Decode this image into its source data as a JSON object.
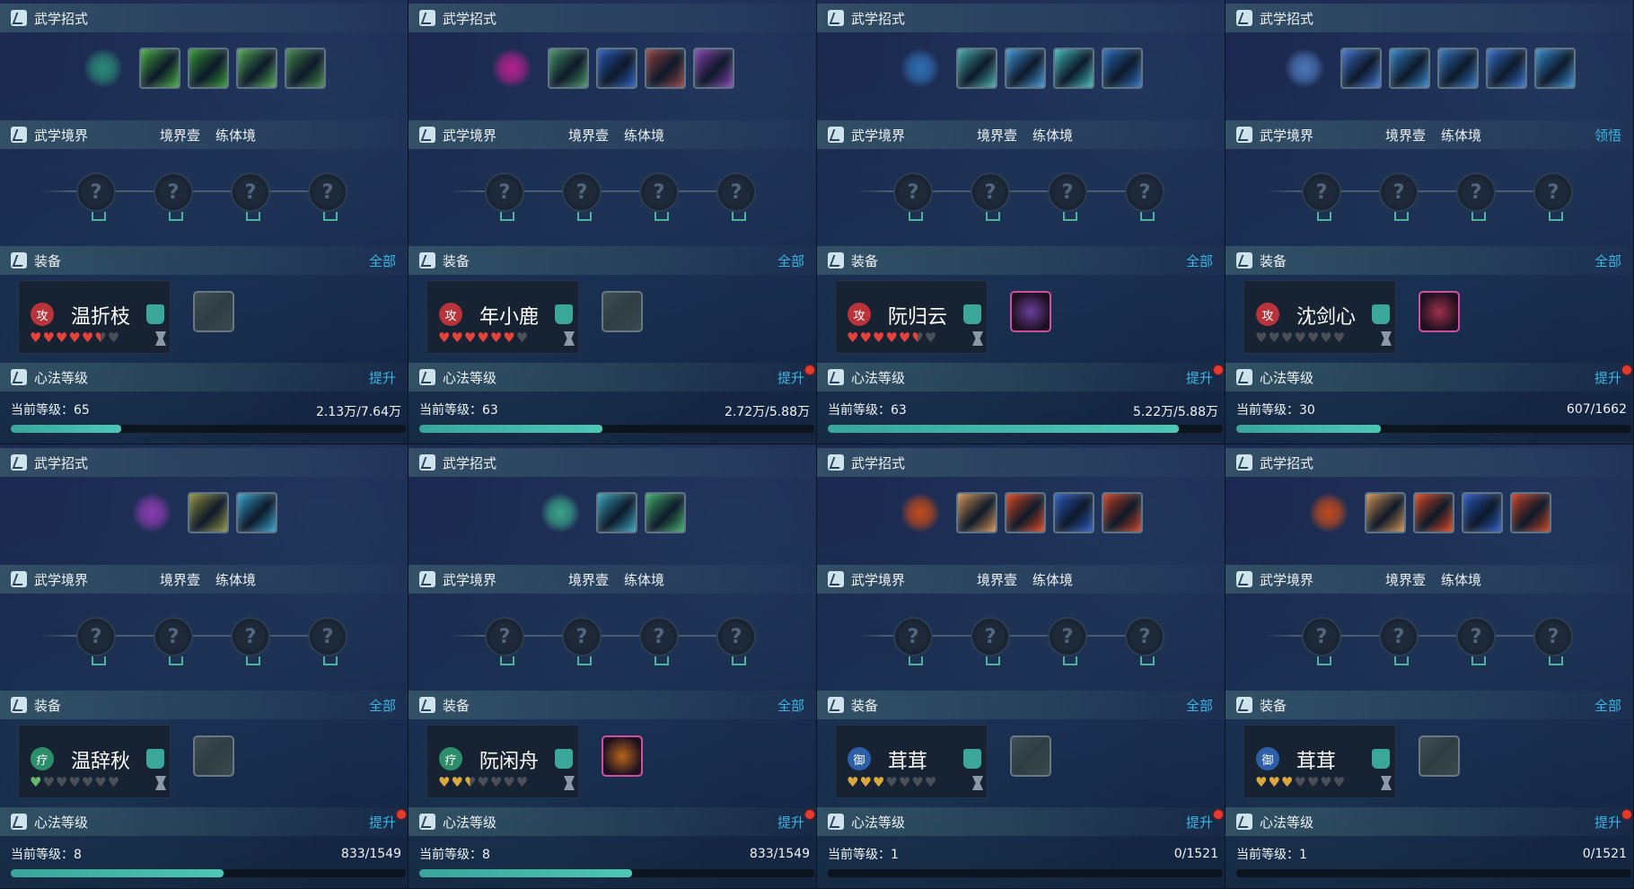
{
  "labels": {
    "skills": "武学招式",
    "realm": "武学境界",
    "realm_level": "境界壹",
    "realm_stage": "练体境",
    "equip": "装备",
    "equip_all": "全部",
    "heart": "心法等级",
    "upgrade": "提升",
    "current_level": "当前等级：",
    "realm_extra": "领悟"
  },
  "colors": {
    "heart_red": "#e3433a",
    "heart_gold": "#d9a93d",
    "heart_empty": "#4b4f57",
    "bar_fill": "#3aa59a",
    "link": "#39b6e3",
    "notice_dot": "#e43b2f"
  },
  "cards": [
    {
      "role": "攻",
      "role_color": "#b8343a",
      "name": "温折枝",
      "hearts": "red",
      "filled": 5.5,
      "skills": [
        "#2a8c78",
        "#3fa63a",
        "#2b8f2e",
        "#4aa04c",
        "#3d7f44"
      ],
      "equip_slot": "empty",
      "equip_color": "",
      "notice": false,
      "realm_extra": false,
      "level": "65",
      "exp": "2.13万/7.64万",
      "progress": 0.279
    },
    {
      "role": "攻",
      "role_color": "#b8343a",
      "name": "年小鹿",
      "hearts": "red",
      "filled": 6,
      "skills": [
        "#b5218f",
        "#3e8a5d",
        "#2255b2",
        "#8c3b3b",
        "#7e3ca6"
      ],
      "equip_slot": "empty",
      "equip_color": "",
      "notice": true,
      "realm_extra": false,
      "level": "63",
      "exp": "2.72万/5.88万",
      "progress": 0.463
    },
    {
      "role": "攻",
      "role_color": "#b8343a",
      "name": "阮归云",
      "hearts": "red",
      "filled": 5.5,
      "skills": [
        "#2f6fb3",
        "#3da4a2",
        "#3a8fcf",
        "#3ab1b2",
        "#2467b5"
      ],
      "equip_slot": "filled",
      "equip_color": "#6b3f9a",
      "notice": true,
      "realm_extra": false,
      "level": "63",
      "exp": "5.22万/5.88万",
      "progress": 0.888
    },
    {
      "role": "攻",
      "role_color": "#b8343a",
      "name": "沈剑心",
      "hearts": "empty",
      "filled": 0,
      "skills": [
        "#4a78b8",
        "#3a6cc7",
        "#2c7fc2",
        "#2d6fb8",
        "#2f68c3",
        "#2f86c7"
      ],
      "equip_slot": "filled",
      "equip_color": "#a0304a",
      "notice": true,
      "realm_extra": true,
      "level": "30",
      "exp": "607/1662",
      "progress": 0.365
    },
    {
      "role": "疗",
      "role_color": "#2c8f6a",
      "name": "温辞秋",
      "hearts": "green",
      "filled": 1,
      "skills": [
        "#8a3cb0",
        "#8a8a3a",
        "#2f9ac2"
      ],
      "equip_slot": "empty",
      "equip_color": "",
      "notice": true,
      "realm_extra": false,
      "level": "8",
      "exp": "833/1549",
      "progress": 0.538
    },
    {
      "role": "疗",
      "role_color": "#2c8f6a",
      "name": "阮闲舟",
      "hearts": "gold",
      "filled": 2.5,
      "skills": [
        "#3aa58a",
        "#2f9ab2",
        "#3aa562"
      ],
      "equip_slot": "filled",
      "equip_color": "#b8661d",
      "notice": true,
      "realm_extra": false,
      "level": "8",
      "exp": "833/1549",
      "progress": 0.538
    },
    {
      "role": "御",
      "role_color": "#2d5fa8",
      "name": "茸茸",
      "hearts": "gold",
      "filled": 3,
      "skills": [
        "#c24a1c",
        "#c98a4a",
        "#d6401a",
        "#2453b8",
        "#c23a1c"
      ],
      "equip_slot": "empty",
      "equip_color": "",
      "notice": true,
      "realm_extra": false,
      "level": "1",
      "exp": "0/1521",
      "progress": 0
    },
    {
      "role": "御",
      "role_color": "#2d5fa8",
      "name": "茸茸",
      "hearts": "gold",
      "filled": 3,
      "skills": [
        "#c24a1c",
        "#c98a4a",
        "#d6401a",
        "#2453b8",
        "#c23a1c"
      ],
      "equip_slot": "empty",
      "equip_color": "",
      "notice": true,
      "realm_extra": false,
      "level": "1",
      "exp": "0/1521",
      "progress": 0
    }
  ]
}
